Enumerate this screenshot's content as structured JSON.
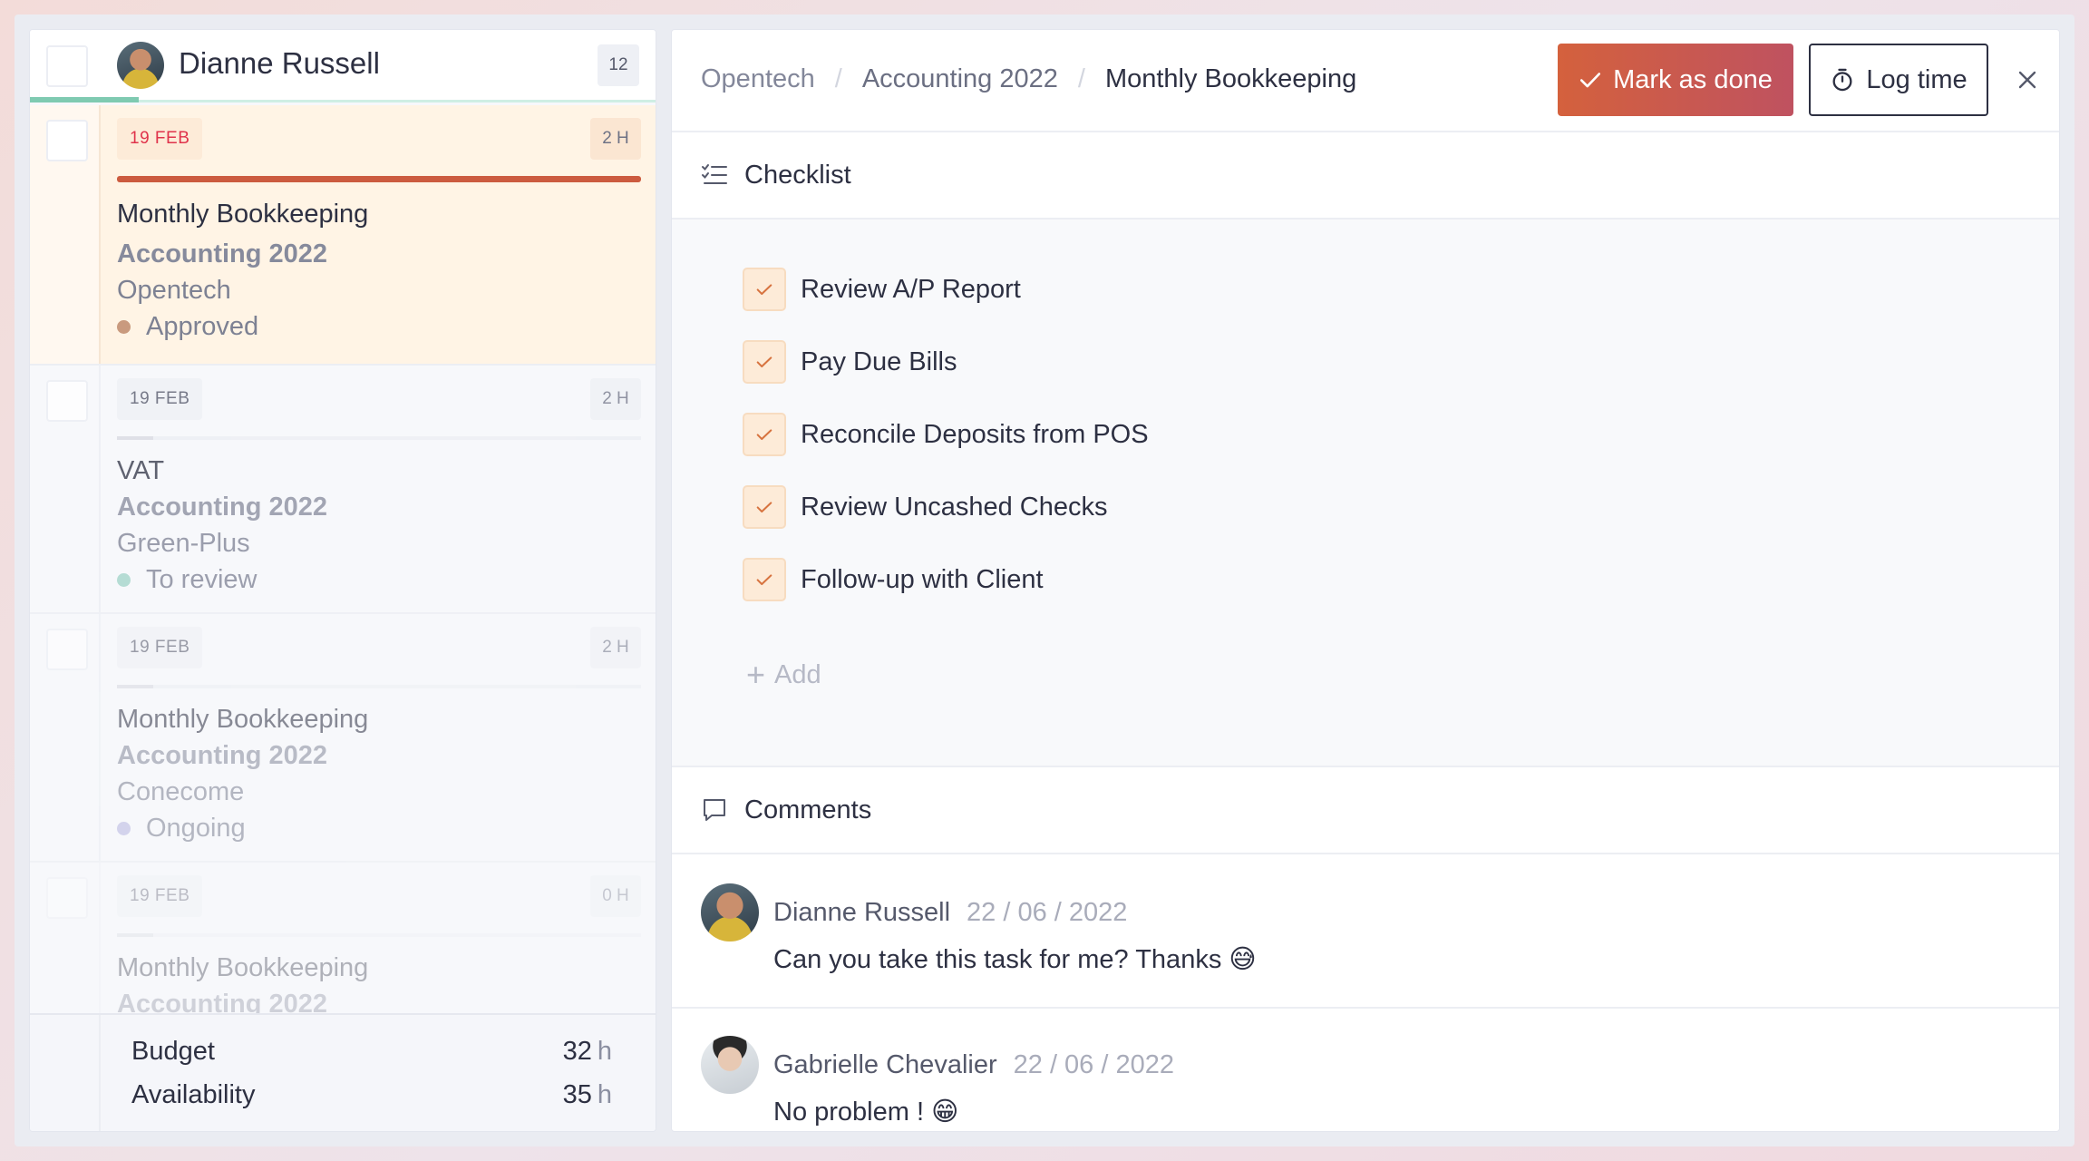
{
  "user": {
    "name": "Dianne Russell",
    "task_count": "12"
  },
  "tasks": [
    {
      "date": "19 FEB",
      "hours": "2 H",
      "title": "Monthly Bookkeeping",
      "project": "Accounting 2022",
      "client": "Opentech",
      "status": "Approved",
      "status_color": "#c99a7e",
      "progress": 1.0
    },
    {
      "date": "19 FEB",
      "hours": "2 H",
      "title": "VAT",
      "project": "Accounting 2022",
      "client": "Green-Plus",
      "status": "To review",
      "status_color": "#9fd3c8",
      "progress": 0.07
    },
    {
      "date": "19 FEB",
      "hours": "2 H",
      "title": "Monthly Bookkeeping",
      "project": "Accounting 2022",
      "client": "Conecome",
      "status": "Ongoing",
      "status_color": "#b7b6e0",
      "progress": 0.07
    },
    {
      "date": "19 FEB",
      "hours": "0 H",
      "title": "Monthly Bookkeeping",
      "project": "Accounting 2022",
      "client": "",
      "status": "",
      "status_color": "#d0d0d0",
      "progress": 0.07
    }
  ],
  "footer": {
    "budget_label": "Budget",
    "budget_value": "32",
    "budget_unit": "h",
    "availability_label": "Availability",
    "availability_value": "35",
    "availability_unit": "h"
  },
  "breadcrumb": {
    "org": "Opentech",
    "project": "Accounting 2022",
    "task": "Monthly Bookkeeping",
    "separator": "/"
  },
  "actions": {
    "mark_done": "Mark as done",
    "log_time": "Log time"
  },
  "checklist": {
    "title": "Checklist",
    "items": [
      "Review A/P Report",
      "Pay Due Bills",
      "Reconcile Deposits from POS",
      "Review Uncashed Checks",
      "Follow-up with Client"
    ],
    "add_label": "Add"
  },
  "comments": {
    "title": "Comments",
    "items": [
      {
        "author": "Dianne Russell",
        "date": "22 / 06 / 2022",
        "text": "Can you take this task for me? Thanks 😅"
      },
      {
        "author": "Gabrielle Chevalier",
        "date": "22 / 06 / 2022",
        "text": "No problem ! 😁"
      }
    ]
  },
  "colors": {
    "accent": "#cc5b3f",
    "check_bg": "#fdebd8",
    "active_card": "#fff4e5"
  }
}
